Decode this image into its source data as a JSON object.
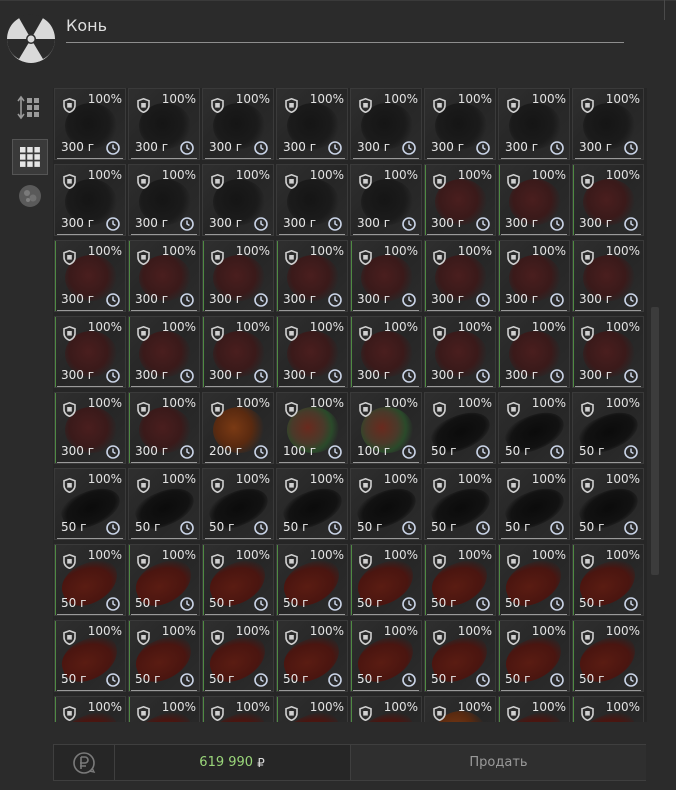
{
  "search": {
    "value": "Конь"
  },
  "footer": {
    "price_value": "619 990",
    "currency_symbol": "₽",
    "sell_label": "Продать"
  },
  "icons": {
    "logo": "radiation-icon",
    "sort": "sort-icon",
    "grid_view": "grid-icon",
    "filter": "meat-icon",
    "currency_exchange": "currency-exchange-icon",
    "condition": "shield-icon",
    "timer": "clock-icon"
  },
  "colors": {
    "background": "#2b2b2b",
    "cell": "#2b2b2b",
    "price": "#9ad67a",
    "text": "#e2e2e2"
  },
  "partial_row_top": {
    "labels": [
      "300 г",
      "300 г",
      "300 г",
      "300 г",
      "300 г",
      "300 г",
      "300 г",
      "300 г"
    ]
  },
  "rows": [
    [
      {
        "pct": "100%",
        "w": "300 г",
        "m": "dark"
      },
      {
        "pct": "100%",
        "w": "300 г",
        "m": "dark"
      },
      {
        "pct": "100%",
        "w": "300 г",
        "m": "dark"
      },
      {
        "pct": "100%",
        "w": "300 г",
        "m": "dark"
      },
      {
        "pct": "100%",
        "w": "300 г",
        "m": "dark"
      },
      {
        "pct": "100%",
        "w": "300 г",
        "m": "dark"
      },
      {
        "pct": "100%",
        "w": "300 г",
        "m": "dark"
      },
      {
        "pct": "100%",
        "w": "300 г",
        "m": "dark"
      }
    ],
    [
      {
        "pct": "100%",
        "w": "300 г",
        "m": "dark"
      },
      {
        "pct": "100%",
        "w": "300 г",
        "m": "dark"
      },
      {
        "pct": "100%",
        "w": "300 г",
        "m": "dark"
      },
      {
        "pct": "100%",
        "w": "300 г",
        "m": "dark"
      },
      {
        "pct": "100%",
        "w": "300 г",
        "m": "dark"
      },
      {
        "pct": "100%",
        "w": "300 г",
        "m": "red"
      },
      {
        "pct": "100%",
        "w": "300 г",
        "m": "red"
      },
      {
        "pct": "100%",
        "w": "300 г",
        "m": "red"
      }
    ],
    [
      {
        "pct": "100%",
        "w": "300 г",
        "m": "red"
      },
      {
        "pct": "100%",
        "w": "300 г",
        "m": "red"
      },
      {
        "pct": "100%",
        "w": "300 г",
        "m": "red"
      },
      {
        "pct": "100%",
        "w": "300 г",
        "m": "red"
      },
      {
        "pct": "100%",
        "w": "300 г",
        "m": "red"
      },
      {
        "pct": "100%",
        "w": "300 г",
        "m": "red"
      },
      {
        "pct": "100%",
        "w": "300 г",
        "m": "red"
      },
      {
        "pct": "100%",
        "w": "300 г",
        "m": "red"
      }
    ],
    [
      {
        "pct": "100%",
        "w": "300 г",
        "m": "red"
      },
      {
        "pct": "100%",
        "w": "300 г",
        "m": "red"
      },
      {
        "pct": "100%",
        "w": "300 г",
        "m": "red"
      },
      {
        "pct": "100%",
        "w": "300 г",
        "m": "red"
      },
      {
        "pct": "100%",
        "w": "300 г",
        "m": "red"
      },
      {
        "pct": "100%",
        "w": "300 г",
        "m": "red"
      },
      {
        "pct": "100%",
        "w": "300 г",
        "m": "red"
      },
      {
        "pct": "100%",
        "w": "300 г",
        "m": "red"
      }
    ],
    [
      {
        "pct": "100%",
        "w": "300 г",
        "m": "red"
      },
      {
        "pct": "100%",
        "w": "300 г",
        "m": "red"
      },
      {
        "pct": "100%",
        "w": "200 г",
        "m": "orange"
      },
      {
        "pct": "100%",
        "w": "100 г",
        "m": "mixed"
      },
      {
        "pct": "100%",
        "w": "100 г",
        "m": "mixed"
      },
      {
        "pct": "100%",
        "w": "50 г",
        "m": "black"
      },
      {
        "pct": "100%",
        "w": "50 г",
        "m": "black"
      },
      {
        "pct": "100%",
        "w": "50 г",
        "m": "black"
      }
    ],
    [
      {
        "pct": "100%",
        "w": "50 г",
        "m": "black"
      },
      {
        "pct": "100%",
        "w": "50 г",
        "m": "black"
      },
      {
        "pct": "100%",
        "w": "50 г",
        "m": "black"
      },
      {
        "pct": "100%",
        "w": "50 г",
        "m": "black"
      },
      {
        "pct": "100%",
        "w": "50 г",
        "m": "black"
      },
      {
        "pct": "100%",
        "w": "50 г",
        "m": "black"
      },
      {
        "pct": "100%",
        "w": "50 г",
        "m": "black"
      },
      {
        "pct": "100%",
        "w": "50 г",
        "m": "black"
      }
    ],
    [
      {
        "pct": "100%",
        "w": "50 г",
        "m": "leg"
      },
      {
        "pct": "100%",
        "w": "50 г",
        "m": "leg"
      },
      {
        "pct": "100%",
        "w": "50 г",
        "m": "leg"
      },
      {
        "pct": "100%",
        "w": "50 г",
        "m": "leg"
      },
      {
        "pct": "100%",
        "w": "50 г",
        "m": "leg"
      },
      {
        "pct": "100%",
        "w": "50 г",
        "m": "leg"
      },
      {
        "pct": "100%",
        "w": "50 г",
        "m": "leg"
      },
      {
        "pct": "100%",
        "w": "50 г",
        "m": "leg"
      }
    ],
    [
      {
        "pct": "100%",
        "w": "50 г",
        "m": "leg"
      },
      {
        "pct": "100%",
        "w": "50 г",
        "m": "leg"
      },
      {
        "pct": "100%",
        "w": "50 г",
        "m": "leg"
      },
      {
        "pct": "100%",
        "w": "50 г",
        "m": "leg"
      },
      {
        "pct": "100%",
        "w": "50 г",
        "m": "leg"
      },
      {
        "pct": "100%",
        "w": "50 г",
        "m": "leg"
      },
      {
        "pct": "100%",
        "w": "50 г",
        "m": "leg"
      },
      {
        "pct": "100%",
        "w": "50 г",
        "m": "leg"
      }
    ],
    [
      {
        "pct": "100%",
        "w": "",
        "m": "leg"
      },
      {
        "pct": "100%",
        "w": "",
        "m": "leg"
      },
      {
        "pct": "100%",
        "w": "",
        "m": "leg"
      },
      {
        "pct": "100%",
        "w": "",
        "m": "leg"
      },
      {
        "pct": "100%",
        "w": "",
        "m": "leg"
      },
      {
        "pct": "100%",
        "w": "",
        "m": "orange"
      },
      {
        "pct": "100%",
        "w": "",
        "m": "leg"
      },
      {
        "pct": "100%",
        "w": "",
        "m": "leg"
      }
    ]
  ]
}
